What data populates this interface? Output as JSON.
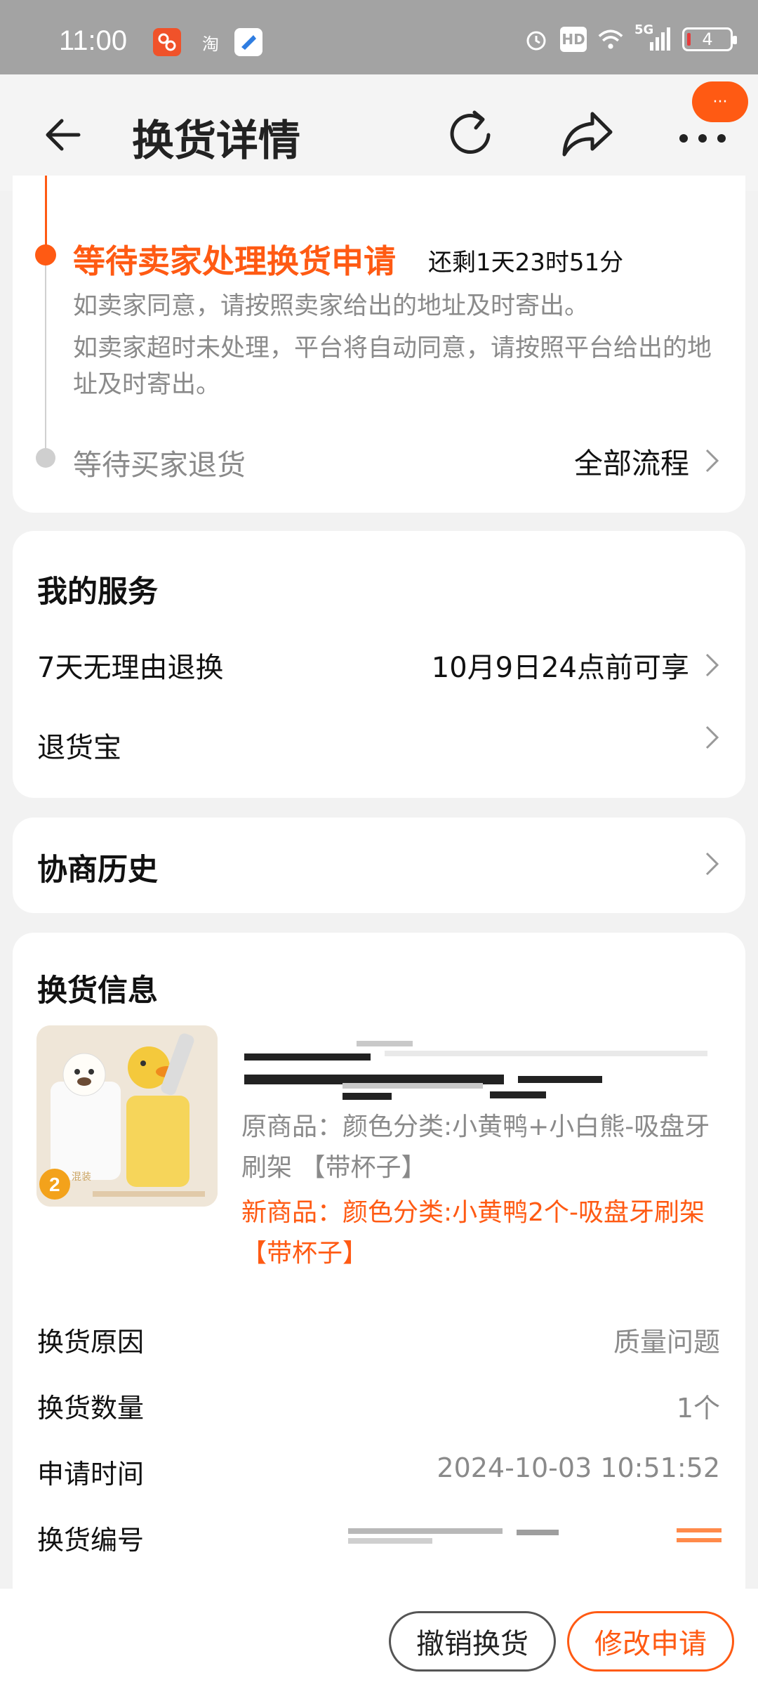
{
  "status_bar": {
    "time": "11:00",
    "app_icons": [
      "app-icon-orange",
      "taobao-icon",
      "blue-app-icon"
    ],
    "taobao_label": "淘",
    "hd_label": "HD",
    "network_label": "5G",
    "battery": "4"
  },
  "nav": {
    "title": "换货详情",
    "badge": "···"
  },
  "progress": {
    "step1_title": "等待卖家处理换货申请",
    "step1_remaining": "还剩1天23时51分",
    "step1_desc1": "如卖家同意，请按照卖家给出的地址及时寄出。",
    "step1_desc2": "如卖家超时未处理，平台将自动同意，请按照平台给出的地址及时寄出。",
    "step2_title": "等待买家退货",
    "all_flow": "全部流程"
  },
  "service": {
    "title": "我的服务",
    "row1_label": "7天无理由退换",
    "row1_value": "10月9日24点前可享",
    "row2_label": "退货宝"
  },
  "history": {
    "title": "协商历史"
  },
  "exchange": {
    "title": "换货信息",
    "original": "原商品：颜色分类:小黄鸭+小白熊-吸盘牙刷架 【带杯子】",
    "new": "新商品：颜色分类:小黄鸭2个-吸盘牙刷架 【带杯子】",
    "rows": [
      {
        "label": "换货原因",
        "value": "质量问题"
      },
      {
        "label": "换货数量",
        "value": "1个"
      },
      {
        "label": "申请时间",
        "value": "2024-10-03 10:51:52"
      },
      {
        "label": "换货编号",
        "value": ""
      }
    ],
    "thumb_badge": "2",
    "thumb_badge_sub": "混装"
  },
  "bottom": {
    "cancel": "撤销换货",
    "modify": "修改申请"
  },
  "colors": {
    "accent": "#ff5a13",
    "gray_text": "#8a8a8a"
  }
}
